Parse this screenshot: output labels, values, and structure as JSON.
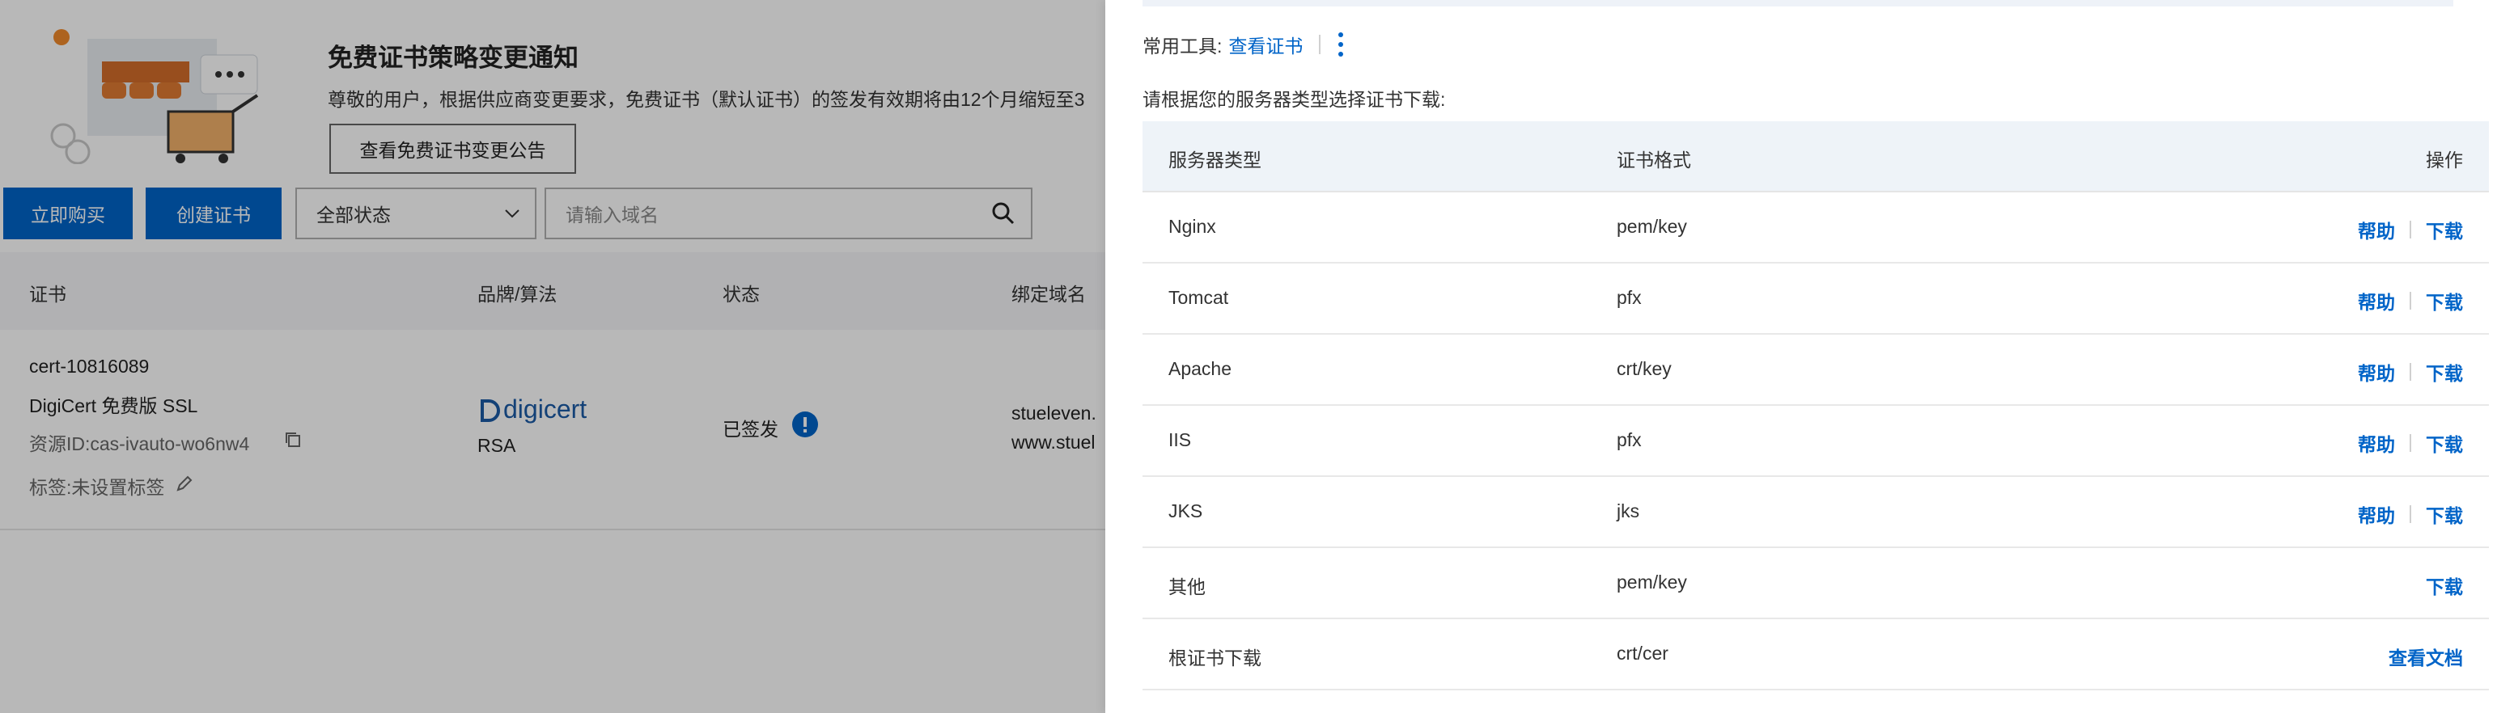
{
  "notice": {
    "title": "免费证书策略变更通知",
    "desc": "尊敬的用户，根据供应商变更要求，免费证书（默认证书）的签发有效期将由12个月缩短至3",
    "button": "查看免费证书变更公告"
  },
  "toolbar": {
    "buy_label": "立即购买",
    "create_label": "创建证书",
    "status_select": "全部状态",
    "search_placeholder": "请输入域名"
  },
  "cert_table": {
    "headers": [
      "证书",
      "品牌/算法",
      "状态",
      "绑定域名"
    ],
    "row": {
      "cert_id": "cert-10816089",
      "cert_name": "DigiCert 免费版 SSL",
      "resource_id": "资源ID:cas-ivauto-wo6nw4",
      "tags": "标签:未设置标签",
      "brand": "digicert",
      "algorithm": "RSA",
      "status": "已签发",
      "domain1": "stueleven.",
      "domain2": "www.stuel"
    }
  },
  "panel": {
    "tools_label": "常用工具:",
    "view_cert_link": "查看证书",
    "intro": "请根据您的服务器类型选择证书下载:",
    "headers": {
      "server": "服务器类型",
      "format": "证书格式",
      "action": "操作"
    },
    "rows": [
      {
        "server": "Nginx",
        "format": "pem/key",
        "help": "帮助",
        "download": "下载"
      },
      {
        "server": "Tomcat",
        "format": "pfx",
        "help": "帮助",
        "download": "下载"
      },
      {
        "server": "Apache",
        "format": "crt/key",
        "help": "帮助",
        "download": "下载"
      },
      {
        "server": "IIS",
        "format": "pfx",
        "help": "帮助",
        "download": "下载"
      },
      {
        "server": "JKS",
        "format": "jks",
        "help": "帮助",
        "download": "下载"
      },
      {
        "server": "其他",
        "format": "pem/key",
        "download": "下载"
      },
      {
        "server": "根证书下载",
        "format": "crt/cer",
        "doc": "查看文档"
      }
    ]
  },
  "colors": {
    "primary": "#0064c8",
    "status_icon": "#0064c8",
    "overlay": "rgba(0,0,0,0.28)"
  }
}
